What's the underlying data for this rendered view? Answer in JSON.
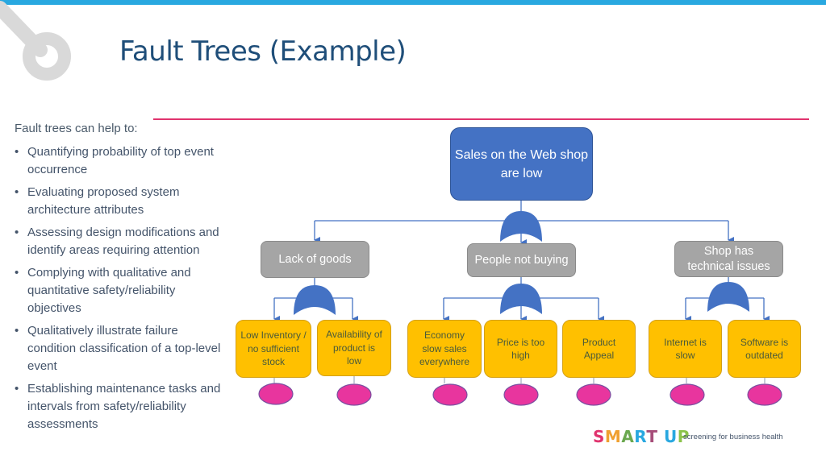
{
  "slide": {
    "title": "Fault Trees (Example)",
    "accent_bar_color": "#29a8e0",
    "divider_color": "#e0336e"
  },
  "left_panel": {
    "intro": "Fault trees can help to:",
    "bullet_glyph": "•",
    "bullets": [
      "Quantifying probability of top event occurrence",
      "Evaluating proposed system architecture attributes",
      "Assessing design modifications and identify areas requiring attention",
      "Complying with qualitative and quantitative safety/reliability objectives",
      "Qualitatively illustrate failure condition classification of a top-level event",
      "Establishing maintenance tasks and intervals from safety/reliability assessments"
    ]
  },
  "fault_tree": {
    "top_event": {
      "label": "Sales on the Web shop are low",
      "color": "#4472c4"
    },
    "gate_type": "OR",
    "gate_color": "#4472c4",
    "intermediate_color": "#a5a5a5",
    "basic_color": "#ffc000",
    "terminal_color": "#e8359e",
    "intermediate_events": [
      {
        "label": "Lack of goods",
        "children": [
          "Low Inventory / no sufficient stock",
          "Availability of product is low"
        ]
      },
      {
        "label": "People not buying",
        "children": [
          "Economy slow sales everywhere",
          "Price is too high",
          "Product Appeal"
        ]
      },
      {
        "label": "Shop has technical issues",
        "children": [
          "Internet is slow",
          "Software is outdated"
        ]
      }
    ]
  },
  "footer": {
    "brand_letters": [
      {
        "ch": "S",
        "color": "#e0336e"
      },
      {
        "ch": "M",
        "color": "#f0a030"
      },
      {
        "ch": "A",
        "color": "#6aa84f"
      },
      {
        "ch": "R",
        "color": "#29a8e0"
      },
      {
        "ch": "T",
        "color": "#a64d79"
      },
      {
        "ch": " ",
        "color": "#000000"
      },
      {
        "ch": "U",
        "color": "#29a8e0"
      },
      {
        "ch": "P",
        "color": "#8bc34a"
      }
    ],
    "tagline": "screening for business health"
  }
}
